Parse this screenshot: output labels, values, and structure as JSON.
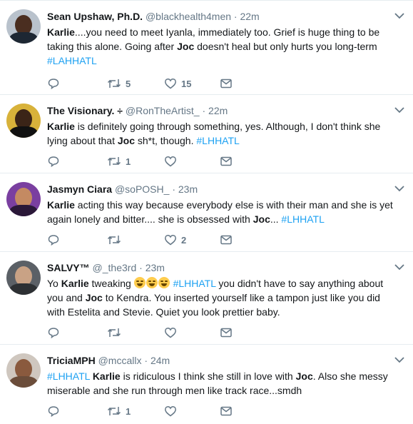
{
  "colors": {
    "link": "#1da1f2",
    "muted": "#657786",
    "text": "#14171a",
    "divider": "#e6ecf0"
  },
  "tweets": [
    {
      "name": "Sean Upshaw, Ph.D.",
      "handle": "@blackhealth4men",
      "dot": "·",
      "time": "22m",
      "text": [
        {
          "t": "Karlie",
          "b": true
        },
        {
          "t": "....you need to meet Iyanla, immediately too. Grief is huge thing to be taking this alone. Going after "
        },
        {
          "t": "Joc",
          "b": true
        },
        {
          "t": " doesn't heal but only hurts you long-term "
        },
        {
          "t": "#LAHHATL",
          "tag": true
        }
      ],
      "retweets": "5",
      "likes": "15"
    },
    {
      "name": "The Visionary. ÷",
      "handle": "@RonTheArtist_",
      "dot": "·",
      "time": "22m",
      "text": [
        {
          "t": "Karlie",
          "b": true
        },
        {
          "t": " is definitely going through something, yes. Although, I don't think she lying about that "
        },
        {
          "t": "Joc",
          "b": true
        },
        {
          "t": " sh*t, though. "
        },
        {
          "t": "#LHHATL",
          "tag": true
        }
      ],
      "retweets": "1",
      "likes": ""
    },
    {
      "name": "Jasmyn Ciara",
      "handle": "@soPOSH_",
      "dot": "·",
      "time": "23m",
      "text": [
        {
          "t": "Karlie",
          "b": true
        },
        {
          "t": " acting this way because everybody else is with their man and she is yet again lonely and bitter.... she is obsessed with "
        },
        {
          "t": "Joc",
          "b": true
        },
        {
          "t": "... "
        },
        {
          "t": "#LHHATL",
          "tag": true
        }
      ],
      "retweets": "",
      "likes": "2"
    },
    {
      "name": "SALVY™",
      "handle": "@_the3rd",
      "dot": "·",
      "time": "23m",
      "text": [
        {
          "t": "Yo "
        },
        {
          "t": "Karlie",
          "b": true
        },
        {
          "t": " tweaking "
        },
        {
          "emoji": 3
        },
        {
          "t": " "
        },
        {
          "t": "#LHHATL",
          "tag": true
        },
        {
          "t": " you didn't have to say anything about you and "
        },
        {
          "t": "Joc",
          "b": true
        },
        {
          "t": " to Kendra. You inserted yourself like a tampon just like you did with Estelita and Stevie. Quiet you look prettier baby."
        }
      ],
      "retweets": "",
      "likes": ""
    },
    {
      "name": "TriciaMPH",
      "handle": "@mccallx",
      "dot": "·",
      "time": "24m",
      "text": [
        {
          "t": "#LHHATL",
          "tag": true
        },
        {
          "t": " "
        },
        {
          "t": "Karlie",
          "b": true
        },
        {
          "t": " is ridiculous I think she still in love with "
        },
        {
          "t": "Joc",
          "b": true
        },
        {
          "t": ". Also she messy miserable and she run through men like track race...smdh"
        }
      ],
      "retweets": "1",
      "likes": ""
    }
  ]
}
